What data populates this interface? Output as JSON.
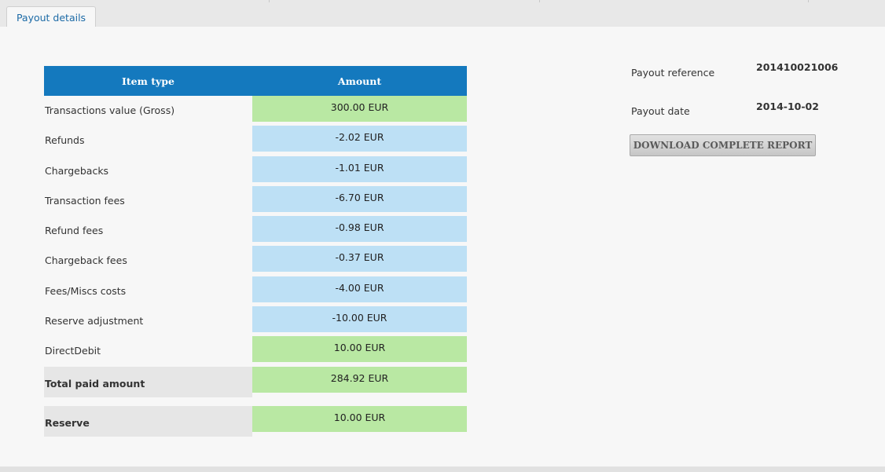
{
  "tabs": [
    {
      "label": "Payout details"
    }
  ],
  "table": {
    "headers": {
      "item_type": "Item type",
      "amount": "Amount"
    },
    "rows": [
      {
        "label": "Transactions value (Gross)",
        "amount": "300.00 EUR",
        "color": "#b9e8a3"
      },
      {
        "label": "Refunds",
        "amount": "-2.02 EUR",
        "color": "#bde0f5"
      },
      {
        "label": "Chargebacks",
        "amount": "-1.01 EUR",
        "color": "#bde0f5"
      },
      {
        "label": "Transaction fees",
        "amount": "-6.70 EUR",
        "color": "#bde0f5"
      },
      {
        "label": "Refund fees",
        "amount": "-0.98 EUR",
        "color": "#bde0f5"
      },
      {
        "label": "Chargeback fees",
        "amount": "-0.37 EUR",
        "color": "#bde0f5"
      },
      {
        "label": "Fees/Miscs costs",
        "amount": "-4.00 EUR",
        "color": "#bde0f5"
      },
      {
        "label": "Reserve adjustment",
        "amount": "-10.00 EUR",
        "color": "#bde0f5"
      },
      {
        "label": "DirectDebit",
        "amount": "10.00 EUR",
        "color": "#b9e8a3"
      }
    ],
    "total": {
      "label": "Total paid amount",
      "amount": "284.92 EUR"
    },
    "reserve": {
      "label": "Reserve",
      "amount": "10.00 EUR"
    }
  },
  "info": {
    "payout_reference_label": "Payout reference",
    "payout_reference_value": "201410021006",
    "payout_date_label": "Payout date",
    "payout_date_value": "2014-10-02"
  },
  "download_button": "DOWNLOAD COMPLETE REPORT",
  "colors": {
    "header_blue": "#1479be",
    "positive_green": "#b9e8a3",
    "negative_blue": "#bde0f5"
  }
}
